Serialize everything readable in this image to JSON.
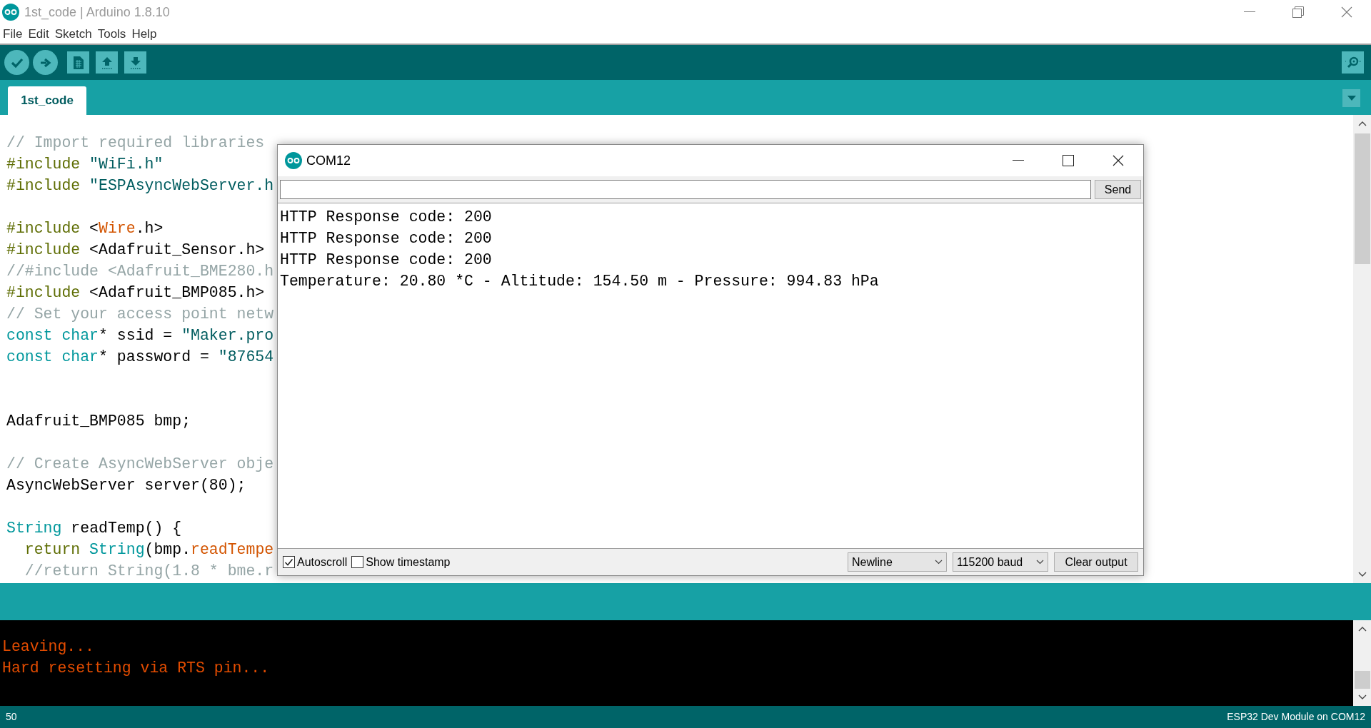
{
  "window": {
    "title": "1st_code | Arduino 1.8.10"
  },
  "menu": [
    "File",
    "Edit",
    "Sketch",
    "Tools",
    "Help"
  ],
  "tabs": [
    {
      "label": "1st_code",
      "selected": true
    }
  ],
  "editor": {
    "lines": [
      {
        "tokens": [
          {
            "kind": "comment",
            "text": "// Import required libraries"
          }
        ]
      },
      {
        "tokens": [
          {
            "kind": "keyword",
            "text": "#include"
          },
          {
            "kind": "string",
            "text": " \"WiFi.h\""
          }
        ]
      },
      {
        "tokens": [
          {
            "kind": "keyword",
            "text": "#include"
          },
          {
            "kind": "string",
            "text": " \"ESPAsyncWebServer.h"
          }
        ]
      },
      {
        "kind": "blank"
      },
      {
        "tokens": [
          {
            "kind": "keyword",
            "text": "#include"
          },
          {
            "kind": "plain",
            "text": " <"
          },
          {
            "kind": "function",
            "text": "Wire"
          },
          {
            "kind": "plain",
            "text": ".h>"
          }
        ]
      },
      {
        "tokens": [
          {
            "kind": "keyword",
            "text": "#include"
          },
          {
            "kind": "plain",
            "text": " <Adafruit_Sensor.h>"
          }
        ]
      },
      {
        "tokens": [
          {
            "kind": "comment",
            "text": "//#include <Adafruit_BME280.h"
          }
        ]
      },
      {
        "tokens": [
          {
            "kind": "keyword",
            "text": "#include"
          },
          {
            "kind": "plain",
            "text": " <Adafruit_BMP085.h>"
          }
        ]
      },
      {
        "tokens": [
          {
            "kind": "comment",
            "text": "// Set your access point netw"
          }
        ]
      },
      {
        "tokens": [
          {
            "kind": "type",
            "text": "const"
          },
          {
            "kind": "type",
            "text": " char"
          },
          {
            "kind": "plain",
            "text": "* ssid = "
          },
          {
            "kind": "string",
            "text": "\"Maker.pro"
          }
        ]
      },
      {
        "tokens": [
          {
            "kind": "type",
            "text": "const"
          },
          {
            "kind": "type",
            "text": " char"
          },
          {
            "kind": "plain",
            "text": "* password = "
          },
          {
            "kind": "string",
            "text": "\"87654"
          }
        ]
      },
      {
        "kind": "blank"
      },
      {
        "kind": "blank"
      },
      {
        "tokens": [
          {
            "kind": "plain",
            "text": "Adafruit_BMP085 bmp;"
          }
        ]
      },
      {
        "kind": "blank"
      },
      {
        "tokens": [
          {
            "kind": "comment",
            "text": "// Create AsyncWebServer obje"
          }
        ]
      },
      {
        "tokens": [
          {
            "kind": "plain",
            "text": "AsyncWebServer server(80);"
          }
        ]
      },
      {
        "kind": "blank"
      },
      {
        "tokens": [
          {
            "kind": "type",
            "text": "String"
          },
          {
            "kind": "plain",
            "text": " readTemp() {"
          }
        ]
      },
      {
        "tokens": [
          {
            "kind": "keyword",
            "text": "  return"
          },
          {
            "kind": "type",
            "text": " String"
          },
          {
            "kind": "plain",
            "text": "(bmp."
          },
          {
            "kind": "function",
            "text": "readTempe"
          }
        ]
      },
      {
        "tokens": [
          {
            "kind": "comment",
            "text": "  //return String(1.8 * bme.r"
          }
        ]
      }
    ]
  },
  "serial_monitor": {
    "title": "COM12",
    "send_button": "Send",
    "output": [
      "HTTP Response code: 200",
      "HTTP Response code: 200",
      "HTTP Response code: 200",
      "Temperature: 20.80 *C - Altitude: 154.50 m - Pressure: 994.83 hPa"
    ],
    "autoscroll": {
      "label": "Autoscroll",
      "checked": true
    },
    "timestamp": {
      "label": "Show timestamp",
      "checked": false
    },
    "line_ending": "Newline",
    "baud": "115200 baud",
    "clear_button": "Clear output"
  },
  "console": {
    "lines": [
      "Leaving...",
      "Hard resetting via RTS pin..."
    ]
  },
  "status_bar": {
    "line": "50",
    "board": "ESP32 Dev Module on COM12"
  }
}
